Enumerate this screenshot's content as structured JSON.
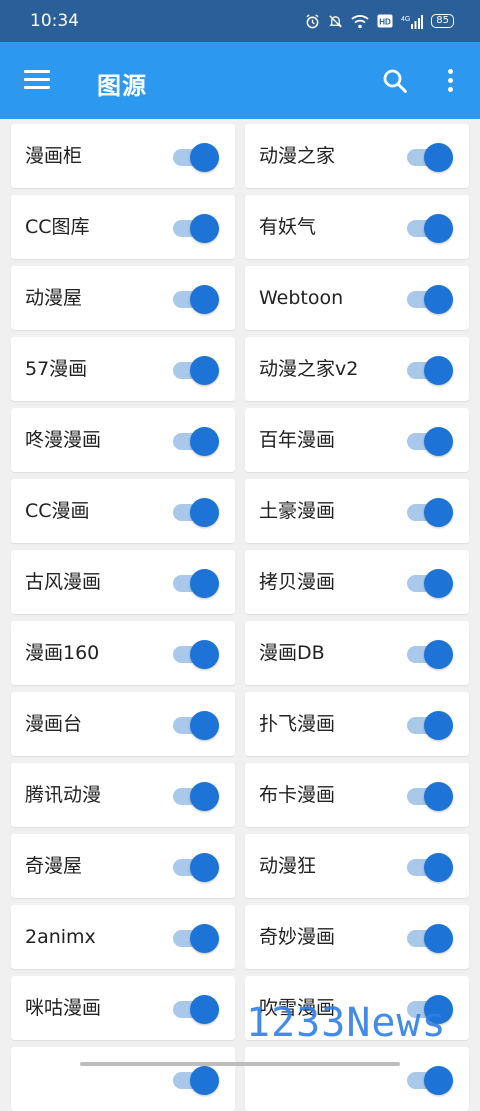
{
  "status_bar": {
    "time": "10:34",
    "battery": "85",
    "icons": [
      "alarm-icon",
      "mute-icon",
      "wifi-icon",
      "hd-icon",
      "4g-signal-icon",
      "battery-icon"
    ]
  },
  "app_bar": {
    "title": "图源",
    "icons": [
      "menu-icon",
      "search-icon",
      "more-vert-icon"
    ],
    "color": "#2c98f0"
  },
  "sources": [
    {
      "name": "漫画柜",
      "enabled": true
    },
    {
      "name": "动漫之家",
      "enabled": true
    },
    {
      "name": "CC图库",
      "enabled": true
    },
    {
      "name": "有妖气",
      "enabled": true
    },
    {
      "name": "动漫屋",
      "enabled": true
    },
    {
      "name": "Webtoon",
      "enabled": true
    },
    {
      "name": "57漫画",
      "enabled": true
    },
    {
      "name": "动漫之家v2",
      "enabled": true
    },
    {
      "name": "咚漫漫画",
      "enabled": true
    },
    {
      "name": "百年漫画",
      "enabled": true
    },
    {
      "name": "CC漫画",
      "enabled": true
    },
    {
      "name": "土豪漫画",
      "enabled": true
    },
    {
      "name": "古风漫画",
      "enabled": true
    },
    {
      "name": "拷贝漫画",
      "enabled": true
    },
    {
      "name": "漫画160",
      "enabled": true
    },
    {
      "name": "漫画DB",
      "enabled": true
    },
    {
      "name": "漫画台",
      "enabled": true
    },
    {
      "name": "扑飞漫画",
      "enabled": true
    },
    {
      "name": "腾讯动漫",
      "enabled": true
    },
    {
      "name": "布卡漫画",
      "enabled": true
    },
    {
      "name": "奇漫屋",
      "enabled": true
    },
    {
      "name": "动漫狂",
      "enabled": true
    },
    {
      "name": "2animx",
      "enabled": true
    },
    {
      "name": "奇妙漫画",
      "enabled": true
    },
    {
      "name": "咪咕漫画",
      "enabled": true
    },
    {
      "name": "吹雪漫画",
      "enabled": true
    },
    {
      "name": "",
      "enabled": true
    },
    {
      "name": "",
      "enabled": true
    }
  ],
  "watermark": "1233News",
  "colors": {
    "status_bar": "#2a5f9a",
    "switch_thumb": "#1e74d6",
    "switch_track": "#a9c8ea"
  }
}
